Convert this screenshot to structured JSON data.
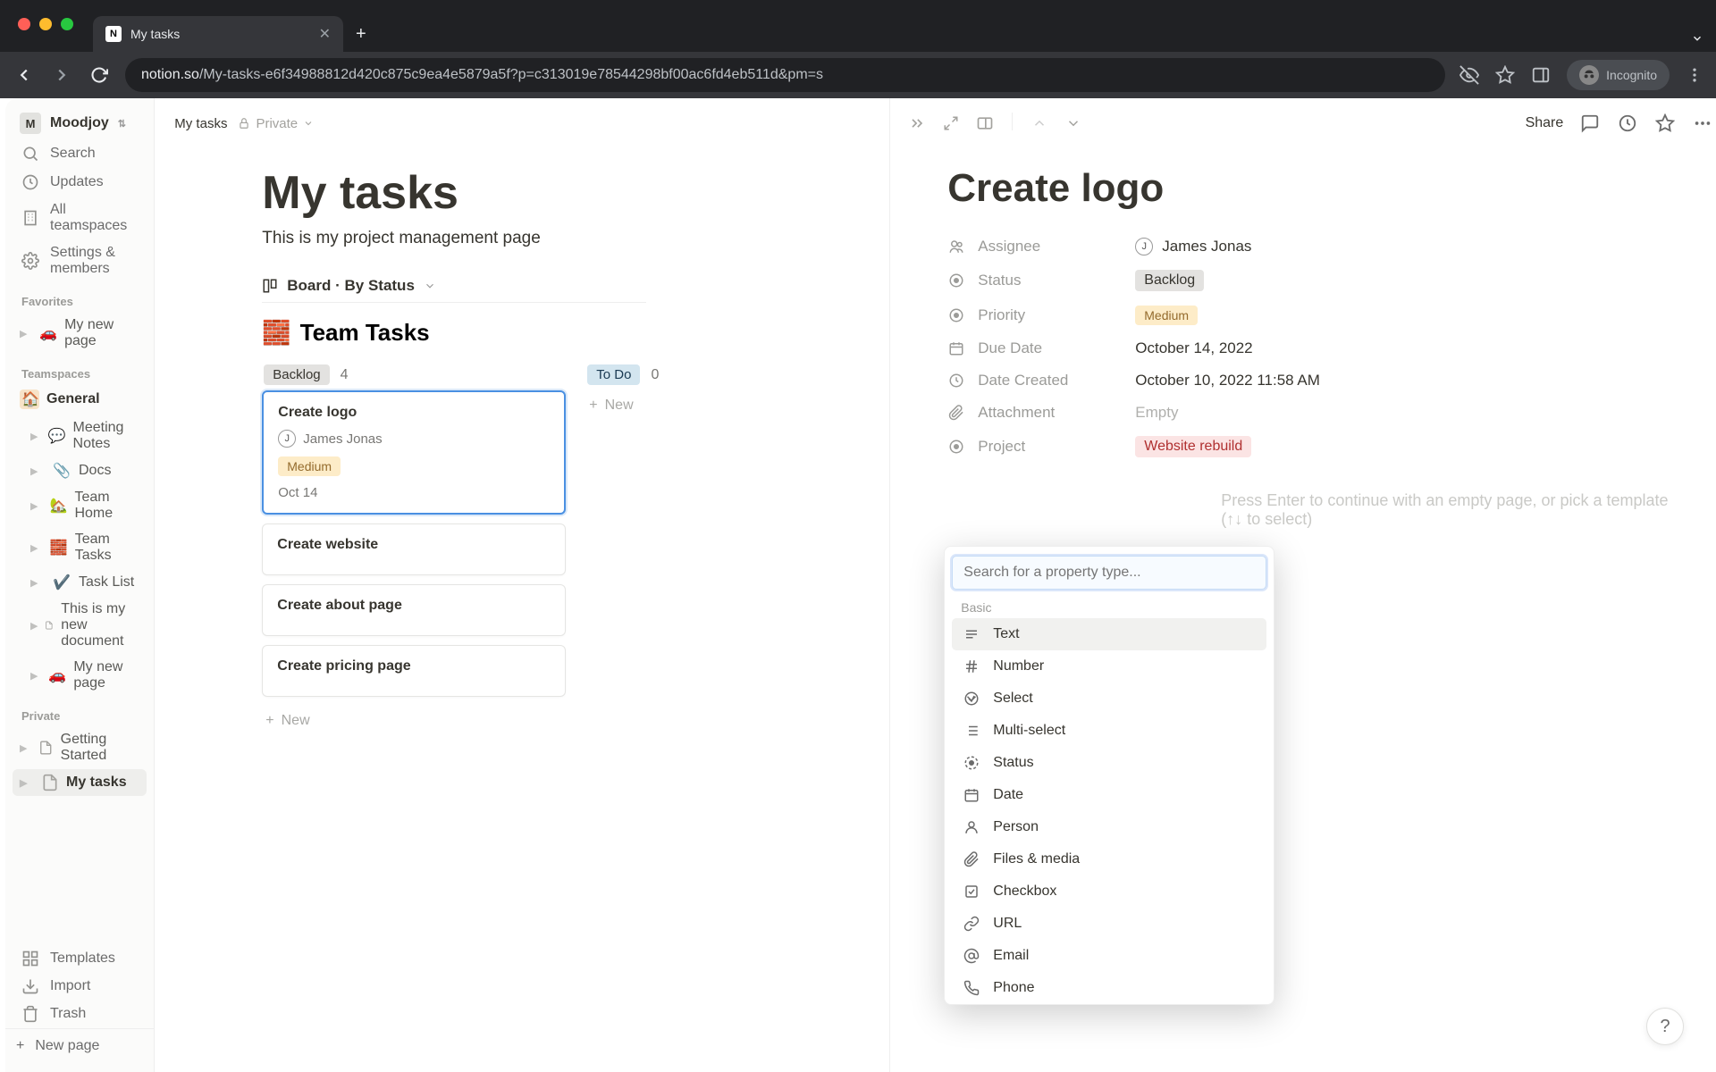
{
  "browser": {
    "tab_title": "My tasks",
    "incognito_label": "Incognito",
    "url_host": "notion.so",
    "url_path": "/My-tasks-e6f34988812d420c875c9ea4e5879a5f?p=c313019e78544298bf00ac6fd4eb511d&pm=s"
  },
  "sidebar": {
    "workspace_name": "Moodjoy",
    "workspace_initial": "M",
    "nav": {
      "search": "Search",
      "updates": "Updates",
      "teamspaces": "All teamspaces",
      "settings": "Settings & members"
    },
    "sections": {
      "favorites": "Favorites",
      "teamspaces": "Teamspaces",
      "private": "Private"
    },
    "favorites": [
      {
        "emoji": "🚗",
        "label": "My new page"
      }
    ],
    "teamspaces_root": {
      "emoji": "🏠",
      "label": "General"
    },
    "teamspace_pages": [
      {
        "emoji": "💬",
        "label": "Meeting Notes"
      },
      {
        "emoji": "📎",
        "label": "Docs"
      },
      {
        "emoji": "🏡",
        "label": "Team Home"
      },
      {
        "emoji": "🧱",
        "label": "Team Tasks"
      },
      {
        "emoji": "✔️",
        "label": "Task List"
      },
      {
        "emoji": "",
        "label": "This is my new document"
      },
      {
        "emoji": "🚗",
        "label": "My new page"
      }
    ],
    "private_pages": [
      {
        "label": "Getting Started",
        "active": false
      },
      {
        "label": "My tasks",
        "active": true
      }
    ],
    "footer": {
      "templates": "Templates",
      "import": "Import",
      "trash": "Trash"
    },
    "new_page": "New page"
  },
  "topbar": {
    "crumb_root": "My tasks",
    "private_label": "Private"
  },
  "board": {
    "title": "My tasks",
    "description": "This is my project management page",
    "view_label": "Board · By Status",
    "db_title": "Team Tasks",
    "db_emoji": "🧱",
    "columns": [
      {
        "name": "Backlog",
        "count": "4",
        "tag_class": "tag-backlog"
      },
      {
        "name": "To Do",
        "count": "0",
        "tag_class": "tag-todo"
      }
    ],
    "cards": [
      {
        "title": "Create logo",
        "assignee": "James Jonas",
        "assignee_initial": "J",
        "priority": "Medium",
        "date": "Oct 14",
        "selected": true
      },
      {
        "title": "Create website"
      },
      {
        "title": "Create about page"
      },
      {
        "title": "Create pricing page"
      }
    ],
    "new_label": "New"
  },
  "panel": {
    "title": "Create logo",
    "share_label": "Share",
    "properties": [
      {
        "icon": "person",
        "label": "Assignee",
        "value": "James Jonas",
        "avatar": "J"
      },
      {
        "icon": "status",
        "label": "Status",
        "value": "Backlog",
        "tag": "backlog"
      },
      {
        "icon": "status",
        "label": "Priority",
        "value": "Medium",
        "tag": "medium"
      },
      {
        "icon": "date",
        "label": "Due Date",
        "value": "October 14, 2022"
      },
      {
        "icon": "clock",
        "label": "Date Created",
        "value": "October 10, 2022 11:58 AM"
      },
      {
        "icon": "attachment",
        "label": "Attachment",
        "value": "Empty",
        "empty": true
      },
      {
        "icon": "status",
        "label": "Project",
        "value": "Website rebuild",
        "tag": "project"
      }
    ],
    "editor_placeholder": "Press Enter to continue with an empty page, or pick a template (↑↓ to select)"
  },
  "popover": {
    "search_placeholder": "Search for a property type...",
    "section_label": "Basic",
    "items": [
      {
        "icon": "text",
        "label": "Text",
        "hovered": true
      },
      {
        "icon": "number",
        "label": "Number"
      },
      {
        "icon": "select",
        "label": "Select"
      },
      {
        "icon": "multiselect",
        "label": "Multi-select"
      },
      {
        "icon": "statusprop",
        "label": "Status"
      },
      {
        "icon": "date",
        "label": "Date"
      },
      {
        "icon": "person",
        "label": "Person"
      },
      {
        "icon": "files",
        "label": "Files & media"
      },
      {
        "icon": "checkbox",
        "label": "Checkbox"
      },
      {
        "icon": "url",
        "label": "URL"
      },
      {
        "icon": "email",
        "label": "Email"
      },
      {
        "icon": "phone",
        "label": "Phone"
      }
    ]
  }
}
